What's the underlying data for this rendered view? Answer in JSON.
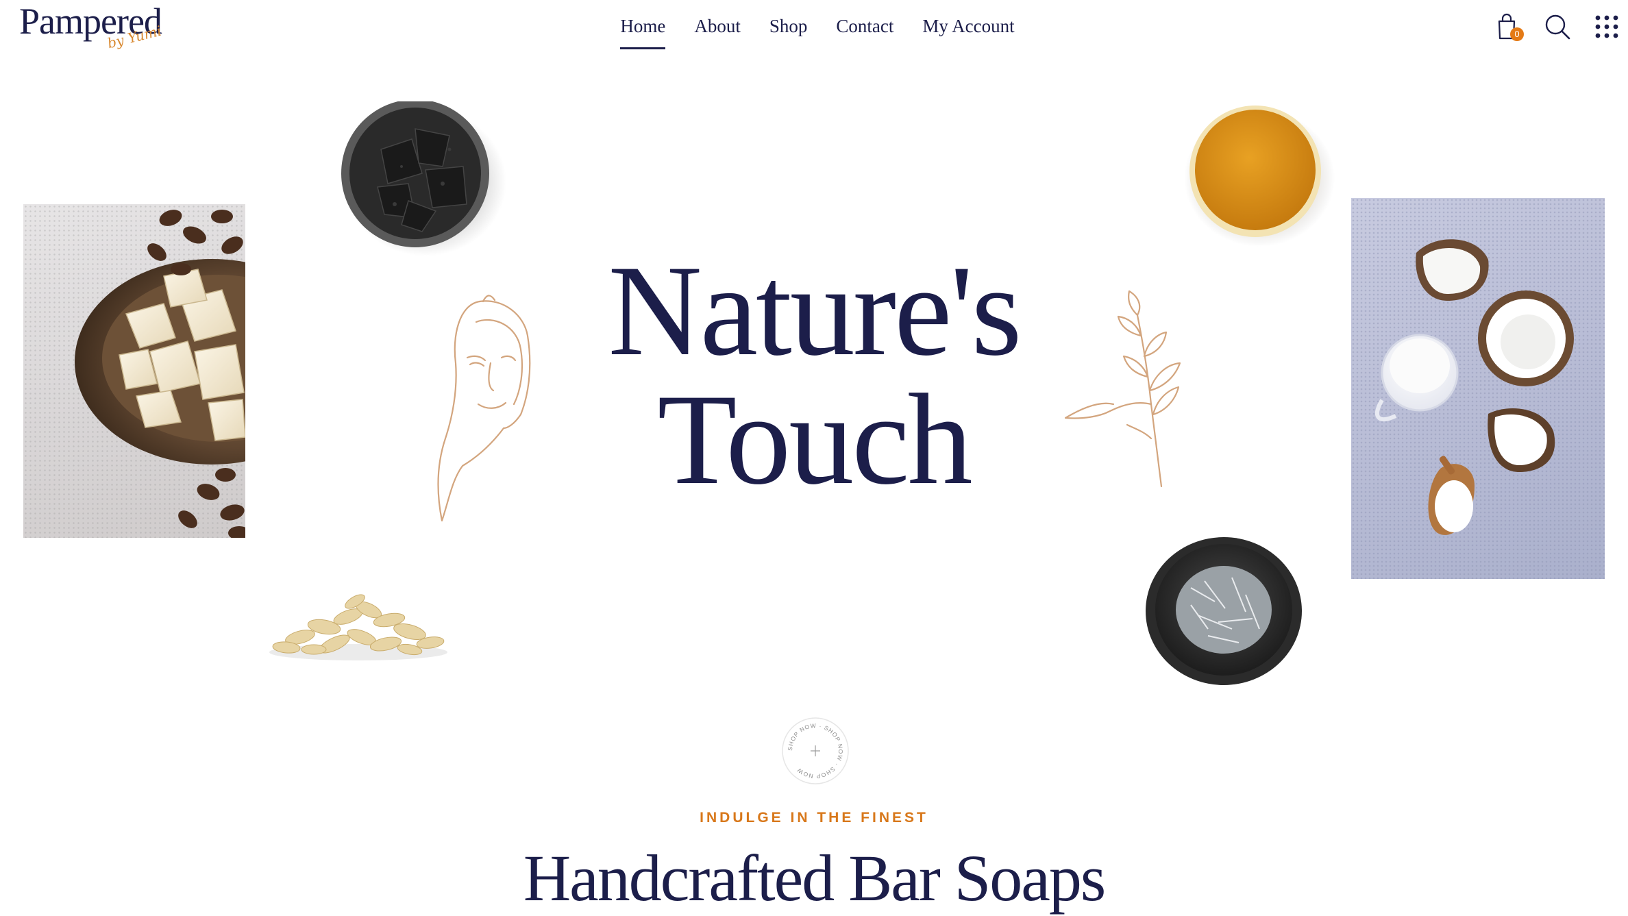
{
  "brand": {
    "name": "Pampered",
    "sub": "by Yumi",
    "navy": "#1c1e4a",
    "accent": "#e47a16",
    "line_art": "#d3a57e"
  },
  "nav": {
    "items": [
      {
        "label": "Home",
        "active": true
      },
      {
        "label": "About"
      },
      {
        "label": "Shop"
      },
      {
        "label": "Contact"
      },
      {
        "label": "My Account"
      }
    ]
  },
  "header_icons": {
    "cart": "shopping-bag-icon",
    "cart_count": "0",
    "search": "search-icon",
    "menu": "grid-menu-icon"
  },
  "hero": {
    "title_line1": "Nature's",
    "title_line2": "Touch"
  },
  "shop_badge": {
    "text": "SHOP NOW · SHOP NOW · SHOP NOW"
  },
  "section": {
    "tagline": "INDULGE IN THE FINEST",
    "title": "Handcrafted Bar Soaps"
  }
}
